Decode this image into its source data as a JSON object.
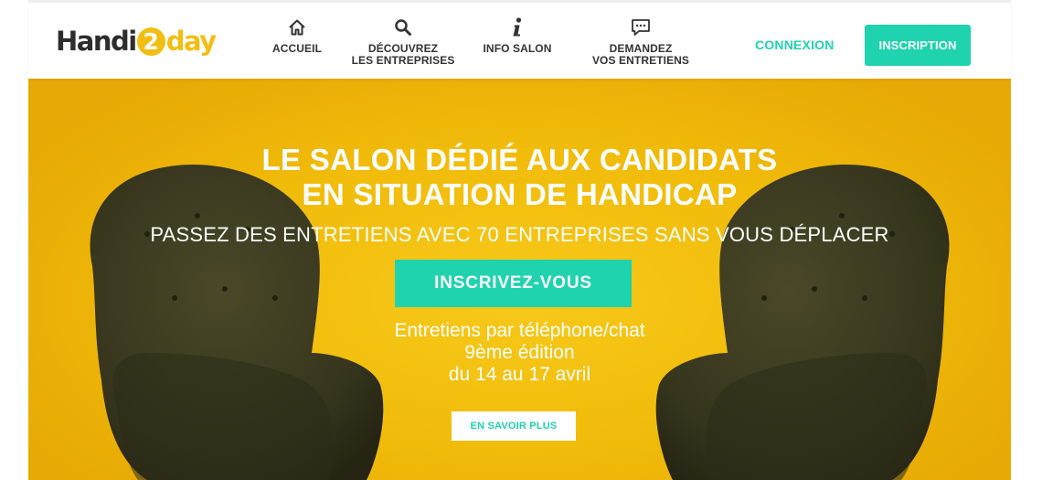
{
  "header": {
    "logo": "Handi2day",
    "nav": [
      {
        "label_line1": "ACCUEIL",
        "label_line2": "",
        "icon": "home-icon"
      },
      {
        "label_line1": "DÉCOUVREZ",
        "label_line2": "LES ENTREPRISES",
        "icon": "search-icon"
      },
      {
        "label_line1": "INFO SALON",
        "label_line2": "",
        "icon": "info-icon"
      },
      {
        "label_line1": "DEMANDEZ",
        "label_line2": "VOS ENTRETIENS",
        "icon": "chat-icon"
      }
    ],
    "login_label": "CONNEXION",
    "signup_label": "INSCRIPTION"
  },
  "hero": {
    "title_line1": "LE SALON DÉDIÉ AUX CANDIDATS",
    "title_line2": "EN SITUATION DE HANDICAP",
    "subtitle": "PASSEZ DES ENTRETIENS AVEC 70 ENTREPRISES SANS VOUS DÉPLACER",
    "cta_label": "INSCRIVEZ-VOUS",
    "details_line1": "Entretiens par téléphone/chat",
    "details_line2": "9ème édition",
    "details_line3": "du 14 au 17 avril",
    "more_label": "EN SAVOIR PLUS"
  },
  "colors": {
    "accent": "#1fd3ae",
    "brand_yellow": "#f3be12",
    "hero_background": "#f1bb0a",
    "chair": "#3b3a22"
  }
}
